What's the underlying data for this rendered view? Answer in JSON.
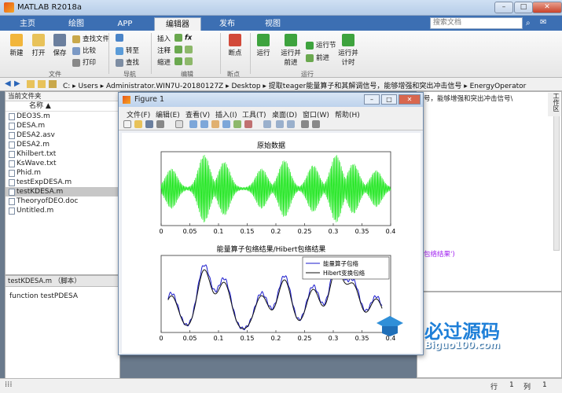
{
  "window": {
    "title": "MATLAB R2018a",
    "min": "–",
    "max": "□",
    "close": "✕"
  },
  "ribbon_tabs": [
    "主页",
    "绘图",
    "APP",
    "编辑器",
    "发布",
    "视图"
  ],
  "search": {
    "placeholder": "搜索文档"
  },
  "ribbon": {
    "new": "新建",
    "open": "打开",
    "save": "保存",
    "find_files": "查找文件",
    "compare": "比较",
    "print": "打印",
    "goto": "转至",
    "find": "查找",
    "insert": "插入",
    "comment": "注释",
    "indent": "缩进",
    "fx": "fx",
    "breakpoints": "断点",
    "run": "运行",
    "run_advance": "运行并\n前进",
    "run_section": "运行节",
    "advance": "前进",
    "run_time": "运行并\n计时",
    "groups": {
      "file": "文件",
      "nav": "导航",
      "edit": "编辑",
      "bp": "断点",
      "run": "运行"
    }
  },
  "address": {
    "path": "C: ▸ Users ▸ Administrator.WIN7U-20180127Z ▸ Desktop ▸ 提取teager能量算子和其解调信号，能够增强和突出冲击信号 ▸ EnergyOperator"
  },
  "current_folder": {
    "title": "当前文件夹",
    "col_name": "名称 ▲",
    "files": [
      "DEO3S.m",
      "DESA.m",
      "DESA2.asv",
      "DESA2.m",
      "Khilbert.txt",
      "KsWave.txt",
      "Phid.m",
      "testExpDESA.m",
      "testKDESA.m",
      "TheoryofDEO.doc",
      "Untitled.m"
    ],
    "selected": "testKDESA.m"
  },
  "details": {
    "header": "testKDESA.m （脚本）",
    "content": "function   testPDESA"
  },
  "editor": {
    "line1": "号，能够增强和突出冲击信号\\",
    "line2": "包络结果')"
  },
  "status": {
    "row_label": "行",
    "row": "1",
    "col_label": "列",
    "col": "1"
  },
  "figure": {
    "title": "Figure 1",
    "menu": [
      "文件(F)",
      "编辑(E)",
      "查看(V)",
      "插入(I)",
      "工具(T)",
      "桌面(D)",
      "窗口(W)",
      "帮助(H)"
    ]
  },
  "chart_data": [
    {
      "type": "line",
      "title": "原始数据",
      "xlim": [
        0,
        0.4
      ],
      "ylim": [
        -1,
        1
      ],
      "x_ticks": [
        "0",
        "0.05",
        "0.1",
        "0.15",
        "0.2",
        "0.25",
        "0.3",
        "0.35",
        "0.4"
      ],
      "color": "#19e619",
      "series": [
        {
          "envelope_centers": [
            0.018,
            0.075,
            0.11,
            0.175,
            0.215,
            0.265,
            0.305,
            0.335,
            0.375
          ],
          "envelope_amps": [
            0.55,
            0.95,
            0.75,
            0.55,
            0.8,
            0.65,
            0.95,
            0.7,
            0.5
          ]
        }
      ]
    },
    {
      "type": "line",
      "title": "能量算子包络结果/Hibert包络结果",
      "xlim": [
        0,
        0.4
      ],
      "x_ticks": [
        "0",
        "0.05",
        "0.1",
        "0.15",
        "0.2",
        "0.25",
        "0.3",
        "0.35",
        "0.4"
      ],
      "legend_position": "top-right",
      "series": [
        {
          "name": "能量算子包络",
          "color": "#1a1acc"
        },
        {
          "name": "Hibert变换包络",
          "color": "#111111"
        }
      ]
    }
  ],
  "watermark": {
    "brand": "必过源码",
    "url": "Biguo100.com"
  }
}
